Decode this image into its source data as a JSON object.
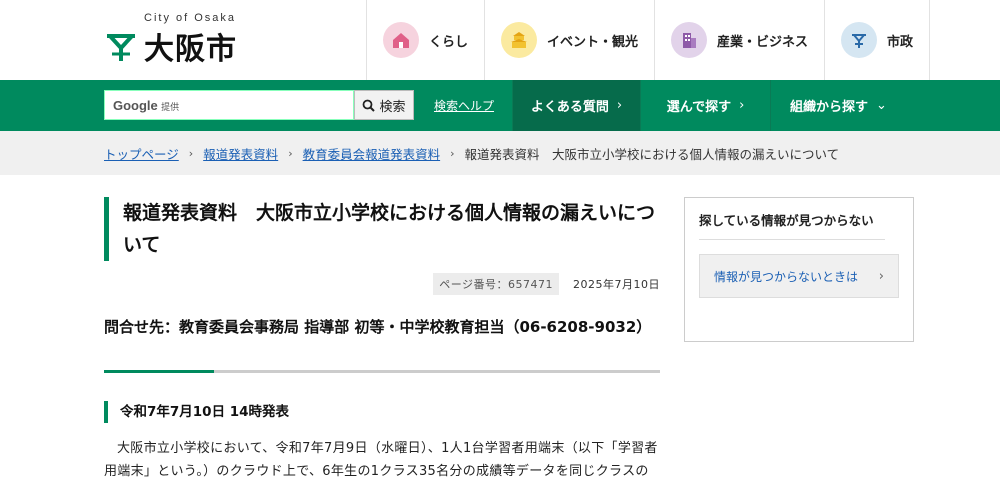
{
  "header": {
    "logo_sub": "City of Osaka",
    "logo_text": "大阪市",
    "categories": [
      {
        "label": "くらし",
        "icon": "house-icon",
        "color": "#f6d3de"
      },
      {
        "label": "イベント・観光",
        "icon": "castle-icon",
        "color": "#fbeaa0"
      },
      {
        "label": "産業・ビジネス",
        "icon": "building-icon",
        "color": "#e2d3ea"
      },
      {
        "label": "市政",
        "icon": "city-emblem-icon",
        "color": "#d5e6f2"
      }
    ]
  },
  "search": {
    "google_label": "Google",
    "provided_label": "提供",
    "button_label": "検索",
    "help_label": "検索ヘルプ"
  },
  "global_nav": [
    {
      "label": "よくある質問",
      "chev": "›"
    },
    {
      "label": "選んで探す",
      "chev": "›"
    },
    {
      "label": "組織から探す",
      "chev": "⌄"
    }
  ],
  "breadcrumb": {
    "items": [
      "トップページ",
      "報道発表資料",
      "教育委員会報道発表資料"
    ],
    "current": "報道発表資料　大阪市立小学校における個人情報の漏えいについて"
  },
  "article": {
    "title": "報道発表資料　大阪市立小学校における個人情報の漏えいについて",
    "page_number": "ページ番号：657471",
    "date": "2025年7月10日",
    "contact": "問合せ先：教育委員会事務局 指導部 初等・中学校教育担当（06-6208-9032）",
    "section_heading": "令和7年7月10日 14時発表",
    "body": "大阪市立小学校において、令和7年7月9日（水曜日）、1人1台学習者用端末（以下「学習者用端末」という。）のクラウド上で、6年生の1クラス35名分の成績等データを同じクラスの児"
  },
  "sidebar": {
    "title": "探している情報が見つからない",
    "link_label": "情報が見つからないときは",
    "link_chev": "›"
  },
  "colors": {
    "brand_green": "#008a5e",
    "link_blue": "#1a5fb4"
  }
}
